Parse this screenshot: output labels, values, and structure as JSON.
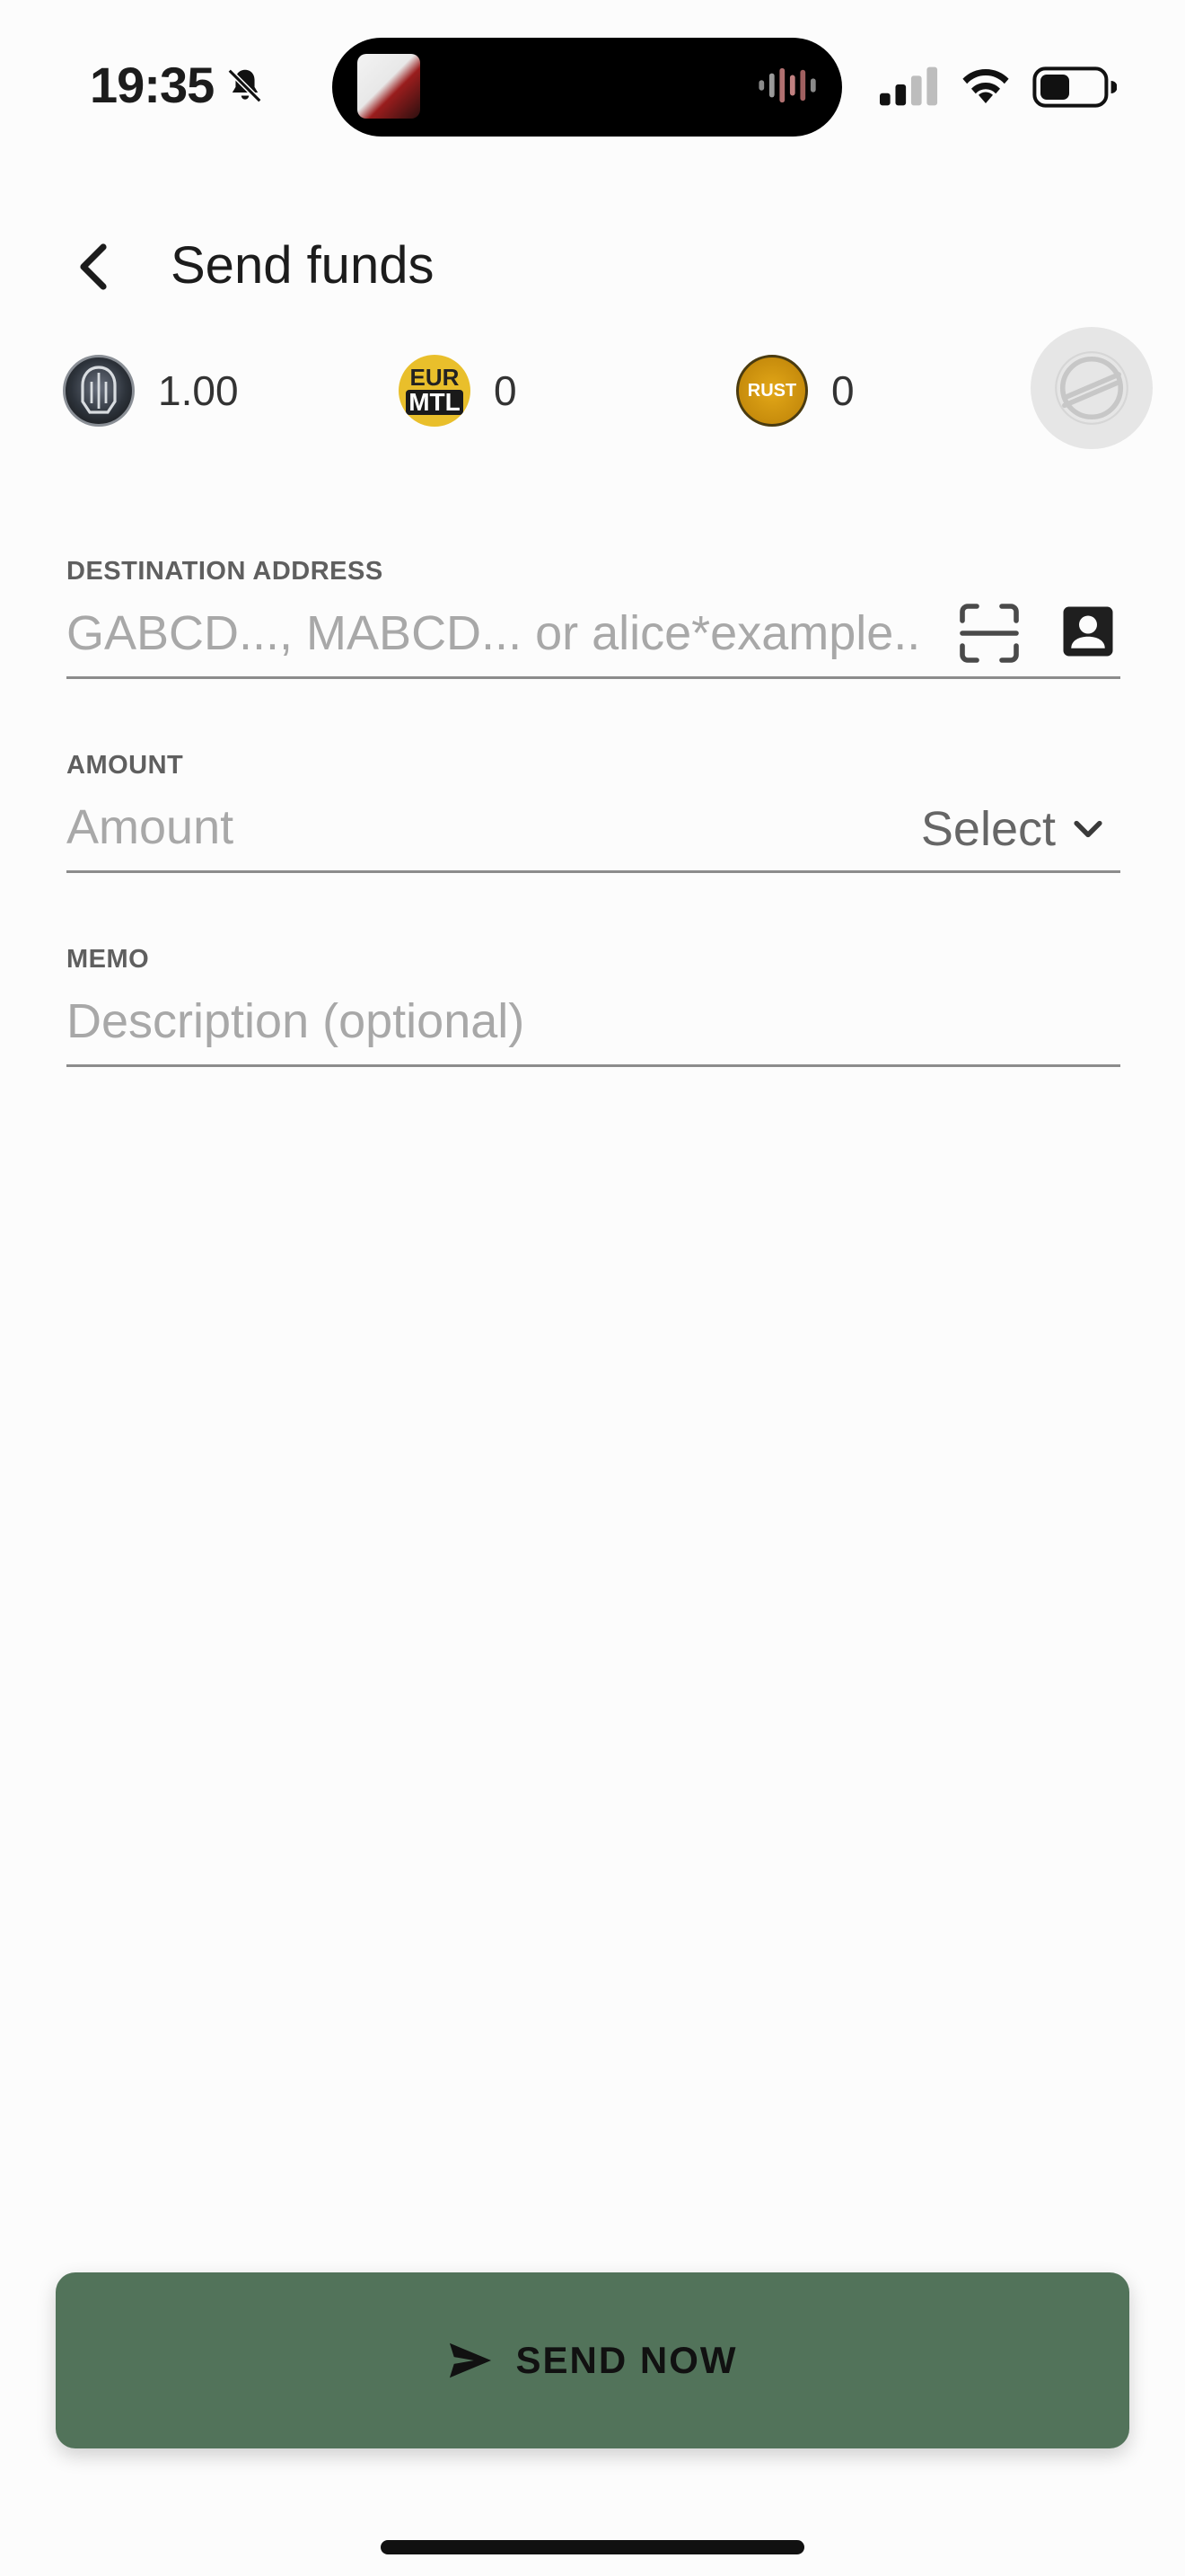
{
  "status_bar": {
    "time": "19:35",
    "icons": [
      "bell-slash-icon",
      "cellular-signal-icon",
      "wifi-icon",
      "battery-icon"
    ]
  },
  "header": {
    "title": "Send funds",
    "back_icon": "chevron-left-icon"
  },
  "assets": [
    {
      "code": "MTL",
      "value": "1.00",
      "logo": "mtl-logo"
    },
    {
      "code": "EURMTL",
      "value": "0",
      "logo": "eurmtl-logo",
      "logo_text_top": "EUR",
      "logo_text_bottom": "MTL"
    },
    {
      "code": "RUST",
      "value": "0",
      "logo": "rust-logo",
      "logo_text": "RUST"
    }
  ],
  "stellar_button_icon": "stellar-icon",
  "form": {
    "destination": {
      "label": "DESTINATION ADDRESS",
      "placeholder": "GABCD..., MABCD... or alice*example...",
      "value": ""
    },
    "amount": {
      "label": "AMOUNT",
      "placeholder": "Amount",
      "value": "",
      "asset_select_label": "Select"
    },
    "memo": {
      "label": "MEMO",
      "placeholder": "Description (optional)",
      "value": ""
    }
  },
  "send_button": {
    "label": "SEND NOW",
    "icon": "send-icon"
  },
  "colors": {
    "background": "#fcfcfc",
    "send_button": "#52735a",
    "eurmtl_gold": "#e9bf2b",
    "rust_gold": "#d49b10"
  }
}
